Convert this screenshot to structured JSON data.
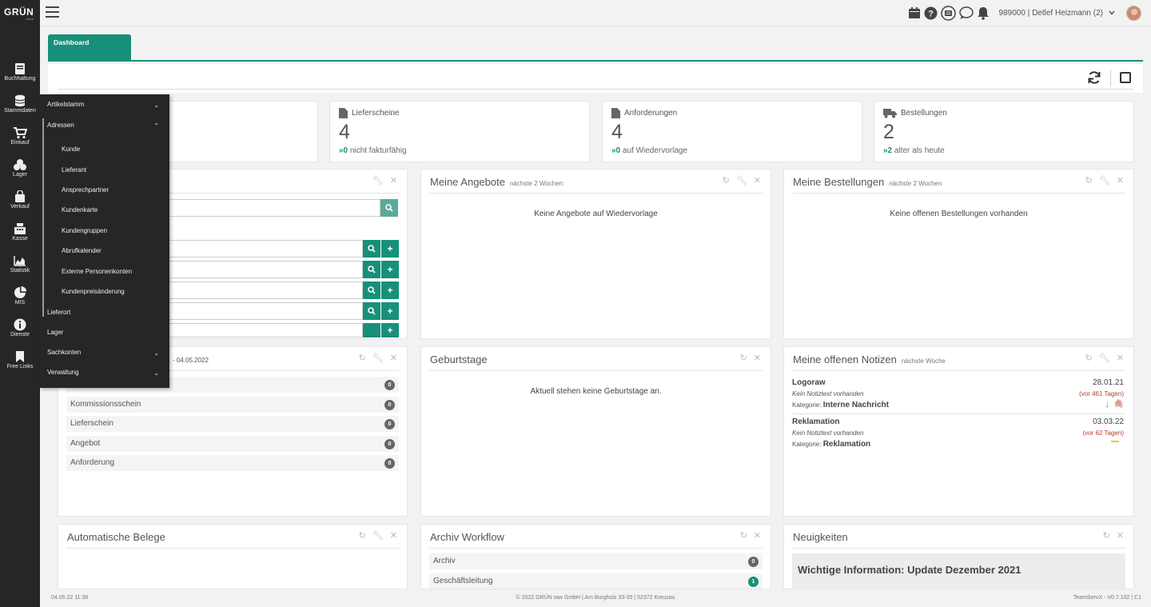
{
  "logo": {
    "text": "GRÜN",
    "sub": "data"
  },
  "sidebar": {
    "items": [
      {
        "label": "Buchhaltung"
      },
      {
        "label": "Stammdaten"
      },
      {
        "label": "Einkauf"
      },
      {
        "label": "Lager"
      },
      {
        "label": "Verkauf"
      },
      {
        "label": "Kasse"
      },
      {
        "label": "Statistik"
      },
      {
        "label": "MIS"
      },
      {
        "label": "Dienste"
      },
      {
        "label": "Free Links"
      }
    ]
  },
  "header": {
    "user": "989000 | Detlef Heizmann (2)",
    "icons": [
      "calendar-icon",
      "help-icon",
      "list-icon",
      "chat-icon",
      "bell-icon"
    ]
  },
  "tabs": {
    "dashboard": "Dashboard"
  },
  "flyout": {
    "items": [
      {
        "label": "Artikelstamm",
        "chevron": "⌄"
      },
      {
        "label": "Adressen",
        "chevron": "⌃"
      },
      {
        "label": "Kunde"
      },
      {
        "label": "Lieferant"
      },
      {
        "label": "Ansprechpartner"
      },
      {
        "label": "Kundenkarte"
      },
      {
        "label": "Kundengruppen"
      },
      {
        "label": "Abrufkalender"
      },
      {
        "label": "Externe Personenkonten"
      },
      {
        "label": "Kundenpreisänderung"
      },
      {
        "label": "Lieferort"
      },
      {
        "label": "Lager"
      },
      {
        "label": "Sachkonten",
        "chevron": "⌄"
      },
      {
        "label": "Verwaltung",
        "chevron": "⌄"
      }
    ]
  },
  "stats": [
    {
      "label": "Lieferscheine",
      "value": "4",
      "arrow": "»0",
      "text": "nicht fakturfähig"
    },
    {
      "label": "Anforderungen",
      "value": "4",
      "arrow": "»0",
      "text": "auf Wiedervorlage"
    },
    {
      "label": "Bestellungen",
      "value": "2",
      "arrow": "»2",
      "text": "alter als heute"
    }
  ],
  "panels": {
    "angebote": {
      "title": "Meine Angebote",
      "hint": "nächste 2 Wochen",
      "empty": "Keine Angebote auf Wiedervorlage"
    },
    "bestellungen": {
      "title": "Meine Bestellungen",
      "hint": "nächste 2 Wochen",
      "empty": "Keine offenen Bestellungen vorhanden"
    },
    "belege": {
      "hint": "- 04.05.2022",
      "rows": [
        {
          "label": "",
          "count": "0"
        },
        {
          "label": "Kommissionsschein",
          "count": "0"
        },
        {
          "label": "Lieferschein",
          "count": "0"
        },
        {
          "label": "Angebot",
          "count": "0"
        },
        {
          "label": "Anforderung",
          "count": "0"
        }
      ]
    },
    "geburtstage": {
      "title": "Geburtstage",
      "empty": "Aktuell stehen keine Geburtstage an."
    },
    "notizen": {
      "title": "Meine offenen Notizen",
      "hint": "nächste Woche",
      "notes": [
        {
          "title": "Logoraw",
          "date": "28.01.21",
          "text": "Kein Notiztext vorhanden",
          "ago": "(vor 461 Tagen)",
          "cat_label": "Kategorie:",
          "cat": "Interne Nachricht"
        },
        {
          "title": "Reklamation",
          "date": "03.03.22",
          "text": "Kein Notiztext vorhanden",
          "ago": "(vor 62 Tagen)",
          "cat_label": "Kategorie:",
          "cat": "Reklamation"
        }
      ]
    },
    "automatische": {
      "title": "Automatische Belege"
    },
    "archiv": {
      "title": "Archiv Workflow",
      "rows": [
        {
          "label": "Archiv",
          "count": "0"
        },
        {
          "label": "Geschäftsleitung",
          "count": "1"
        }
      ]
    },
    "neuigkeiten": {
      "title": "Neuigkeiten",
      "headline": "Wichtige Information: Update Dezember 2021"
    }
  },
  "footer": {
    "left": "04.05.22 11:39",
    "center": "© 2022 GRÜN raw GmbH | Am Burgholz 33-35 | 52372 Kreuzau",
    "right": "TeamServX - V0.7.102 | C1"
  },
  "colors": {
    "accent": "#17907a",
    "sidebar": "#262626",
    "warning": "#c0392b"
  }
}
